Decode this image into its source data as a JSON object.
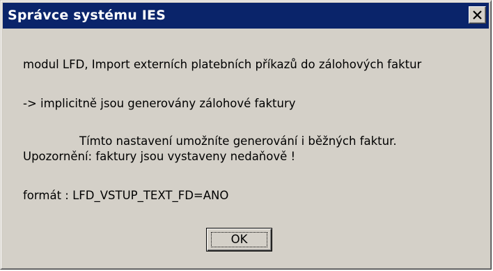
{
  "dialog": {
    "title": "Správce systému IES",
    "close_icon": "close-icon",
    "message_lines": [
      "modul LFD, Import externích platebních příkazů do zálohových faktur",
      "-> implicitně jsou generovány zálohové faktury",
      "Tímto nastavení umožníte generování i běžných faktur.",
      "Upozornění: faktury jsou vystaveny nedaňově !",
      "formát : LFD_VSTUP_TEXT_FD=ANO"
    ],
    "ok_label": "OK"
  },
  "colors": {
    "titlebar": "#0a246a",
    "face": "#d4d0c8"
  }
}
